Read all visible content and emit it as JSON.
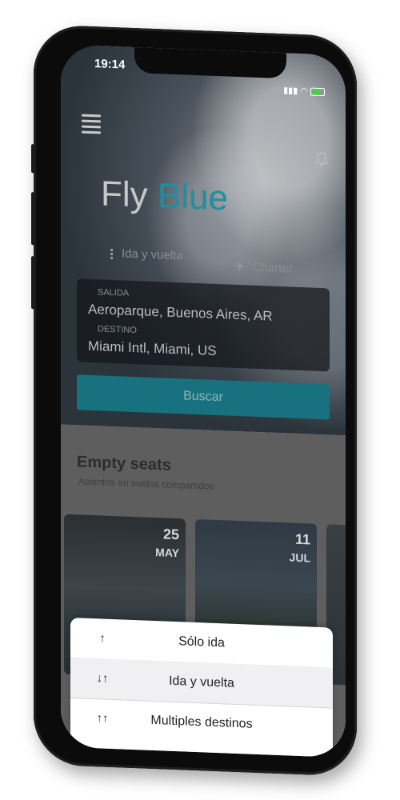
{
  "status": {
    "time": "19:14"
  },
  "brand": {
    "part1": "Fly",
    "part2": "Blue"
  },
  "trip_tabs": {
    "roundtrip": "Ida y vuelta",
    "charter": "Charter"
  },
  "route": {
    "origin_label": "SALIDA",
    "origin_value": "Aeroparque, Buenos Aires, AR",
    "destination_label": "DESTINO",
    "destination_value": "Miami Intl, Miami, US"
  },
  "search_button": "Buscar",
  "section": {
    "title": "Empty seats",
    "subtitle": "Asientos en vuelos compartidos"
  },
  "cards": [
    {
      "day": "25",
      "month": "MAY"
    },
    {
      "day": "11",
      "month": "JUL"
    }
  ],
  "sheet": {
    "options": [
      {
        "label": "Sólo ida",
        "icon": "arrow-up-icon"
      },
      {
        "label": "Ida y vuelta",
        "icon": "arrows-updown-icon"
      },
      {
        "label": "Multiples destinos",
        "icon": "double-arrow-up-icon"
      }
    ],
    "selected": "Ida y vuelta"
  },
  "colors": {
    "accent": "#1f8ea0",
    "overlay": "#000000"
  }
}
